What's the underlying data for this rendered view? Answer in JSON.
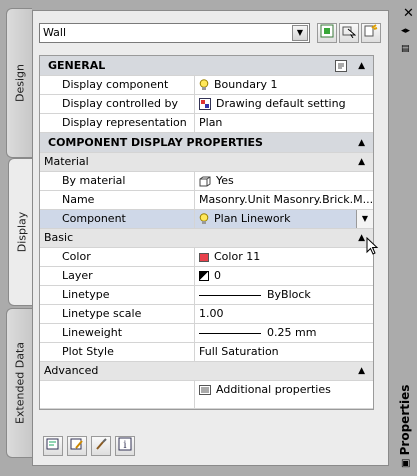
{
  "window": {
    "title": "Properties"
  },
  "tabs": [
    {
      "label": "Design"
    },
    {
      "label": "Display"
    },
    {
      "label": "Extended Data"
    }
  ],
  "object_selector": {
    "value": "Wall"
  },
  "sections": {
    "general": {
      "title": "GENERAL",
      "rows": [
        {
          "label": "Display component",
          "value": "Boundary 1"
        },
        {
          "label": "Display controlled by",
          "value": "Drawing default setting"
        },
        {
          "label": "Display representation",
          "value": "Plan"
        }
      ]
    },
    "cdp": {
      "title": "COMPONENT DISPLAY PROPERTIES",
      "material": {
        "title": "Material",
        "rows": [
          {
            "label": "By material",
            "value": "Yes"
          },
          {
            "label": "Name",
            "value": "Masonry.Unit Masonry.Brick.M..."
          },
          {
            "label": "Component",
            "value": "Plan Linework"
          }
        ]
      },
      "basic": {
        "title": "Basic",
        "rows": [
          {
            "label": "Color",
            "value": "Color 11"
          },
          {
            "label": "Layer",
            "value": "0"
          },
          {
            "label": "Linetype",
            "value": "ByBlock"
          },
          {
            "label": "Linetype scale",
            "value": "1.00"
          },
          {
            "label": "Lineweight",
            "value": "0.25 mm"
          },
          {
            "label": "Plot Style",
            "value": "Full Saturation"
          }
        ]
      },
      "advanced": {
        "title": "Advanced",
        "rows": [
          {
            "label": "",
            "value": "Additional properties"
          }
        ]
      }
    }
  },
  "colors": {
    "color11": "#e8414b",
    "selected_row": "#cfd8e8",
    "category_header": "#d6d9de"
  }
}
